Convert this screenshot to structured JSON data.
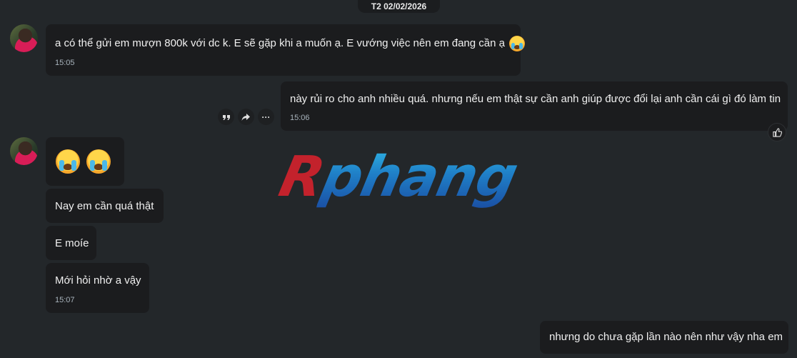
{
  "date_divider": "T2 02/02/2026",
  "messages": {
    "m1": {
      "text": "a có thể gửi em mượn 800k với dc k. E sẽ gặp khi a muốn ạ. E vướng việc nên em đang cần ạ",
      "emoji": "crying-face",
      "time": "15:05"
    },
    "m2": {
      "text": "này rủi ro cho anh nhiều quá. nhưng nếu em thật sự cần anh giúp được đổi lại anh cần cái gì đó làm tin",
      "time": "15:06"
    },
    "m3": {
      "emoji": [
        "crying-face",
        "crying-face"
      ]
    },
    "m4": {
      "text": "Nay em cần quá thật"
    },
    "m5": {
      "text": "E moíe"
    },
    "m6": {
      "text": "Mới hỏi nhờ a vậy",
      "time": "15:07"
    },
    "m7": {
      "text": "nhưng do chưa gặp lần nào nên như vậy nha em"
    }
  },
  "actions": {
    "quote_icon": "quote-icon",
    "forward_icon": "forward-icon",
    "more_label": "···",
    "like_icon": "thumbs-up-icon"
  },
  "watermark": {
    "first": "R",
    "rest": "phang"
  },
  "colors": {
    "background": "#23272a",
    "bubble": "#1b1c1e",
    "time": "#a9b4bd"
  }
}
